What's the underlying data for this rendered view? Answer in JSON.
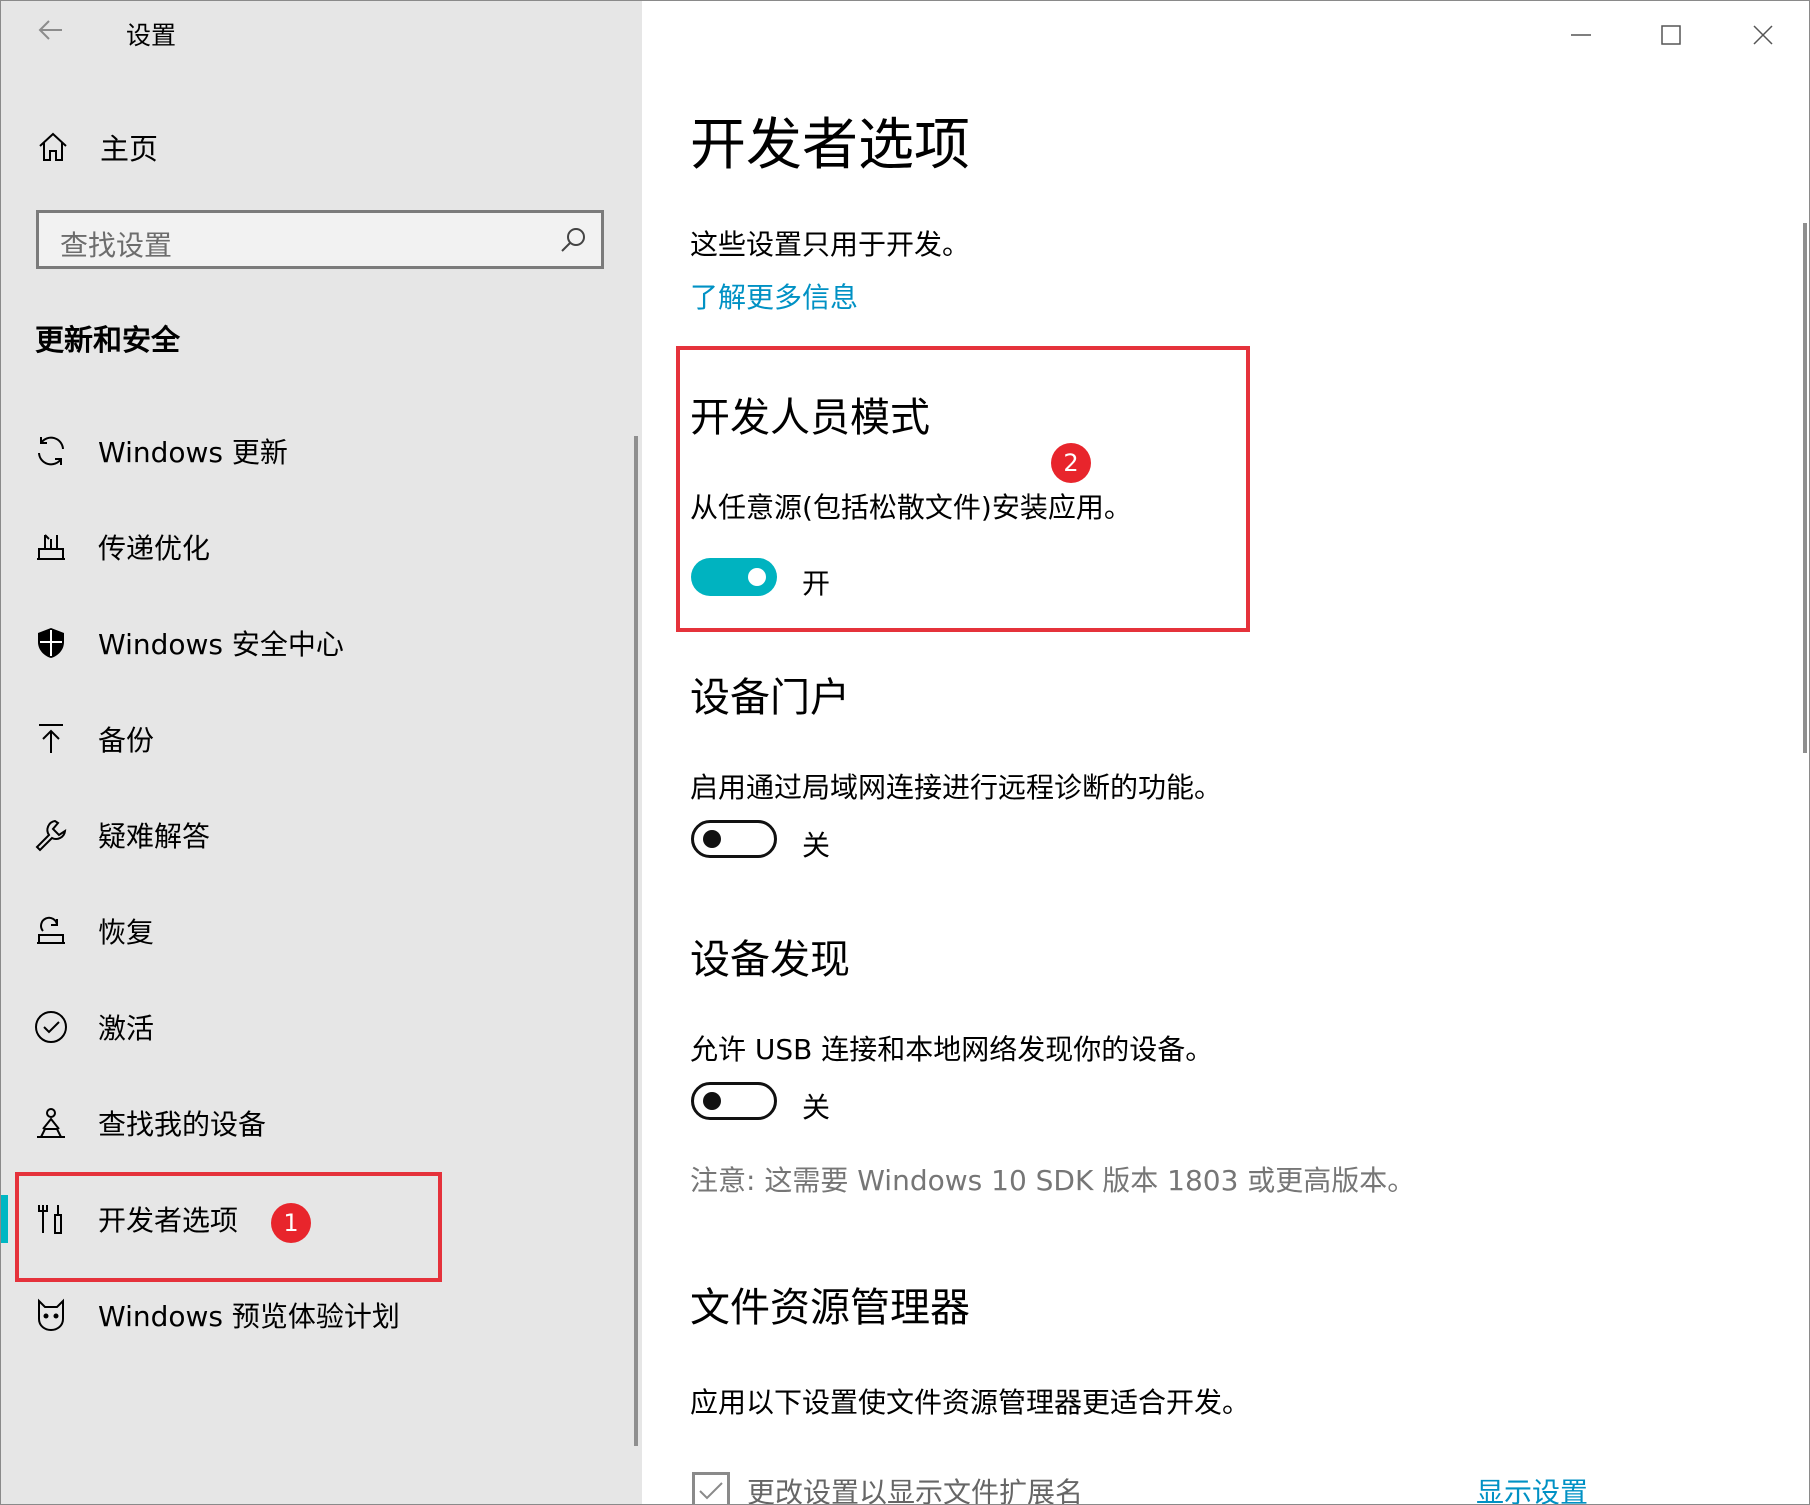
{
  "window": {
    "title": "设置"
  },
  "sidebar": {
    "home_label": "主页",
    "search_placeholder": "查找设置",
    "section_title": "更新和安全",
    "items": [
      {
        "label": "Windows 更新",
        "icon": "sync-icon"
      },
      {
        "label": "传递优化",
        "icon": "delivery-icon"
      },
      {
        "label": "Windows 安全中心",
        "icon": "shield-icon"
      },
      {
        "label": "备份",
        "icon": "upload-icon"
      },
      {
        "label": "疑难解答",
        "icon": "wrench-icon"
      },
      {
        "label": "恢复",
        "icon": "recovery-icon"
      },
      {
        "label": "激活",
        "icon": "check-circle-icon"
      },
      {
        "label": "查找我的设备",
        "icon": "person-location-icon"
      },
      {
        "label": "开发者选项",
        "icon": "developer-tools-icon",
        "active": true
      },
      {
        "label": "Windows 预览体验计划",
        "icon": "insider-cat-icon"
      }
    ]
  },
  "main": {
    "title": "开发者选项",
    "description": "这些设置只用于开发。",
    "learn_more": "了解更多信息",
    "developer_mode": {
      "heading": "开发人员模式",
      "text": "从任意源(包括松散文件)安装应用。",
      "state": "开"
    },
    "device_portal": {
      "heading": "设备门户",
      "text": "启用通过局域网连接进行远程诊断的功能。",
      "state": "关"
    },
    "device_discovery": {
      "heading": "设备发现",
      "text": "允许 USB 连接和本地网络发现你的设备。",
      "state": "关",
      "note": "注意: 这需要 Windows 10 SDK 版本 1803 或更高版本。"
    },
    "file_explorer": {
      "heading": "文件资源管理器",
      "text": "应用以下设置使文件资源管理器更适合开发。",
      "checkbox_label": "更改设置以显示文件扩展名",
      "show_settings": "显示设置"
    }
  },
  "annotations": {
    "badge1": "1",
    "badge2": "2"
  },
  "colors": {
    "accent": "#00b3c0",
    "link": "#0091c4",
    "highlight": "#e5323b",
    "sidebar_bg": "#e6e6e6"
  }
}
